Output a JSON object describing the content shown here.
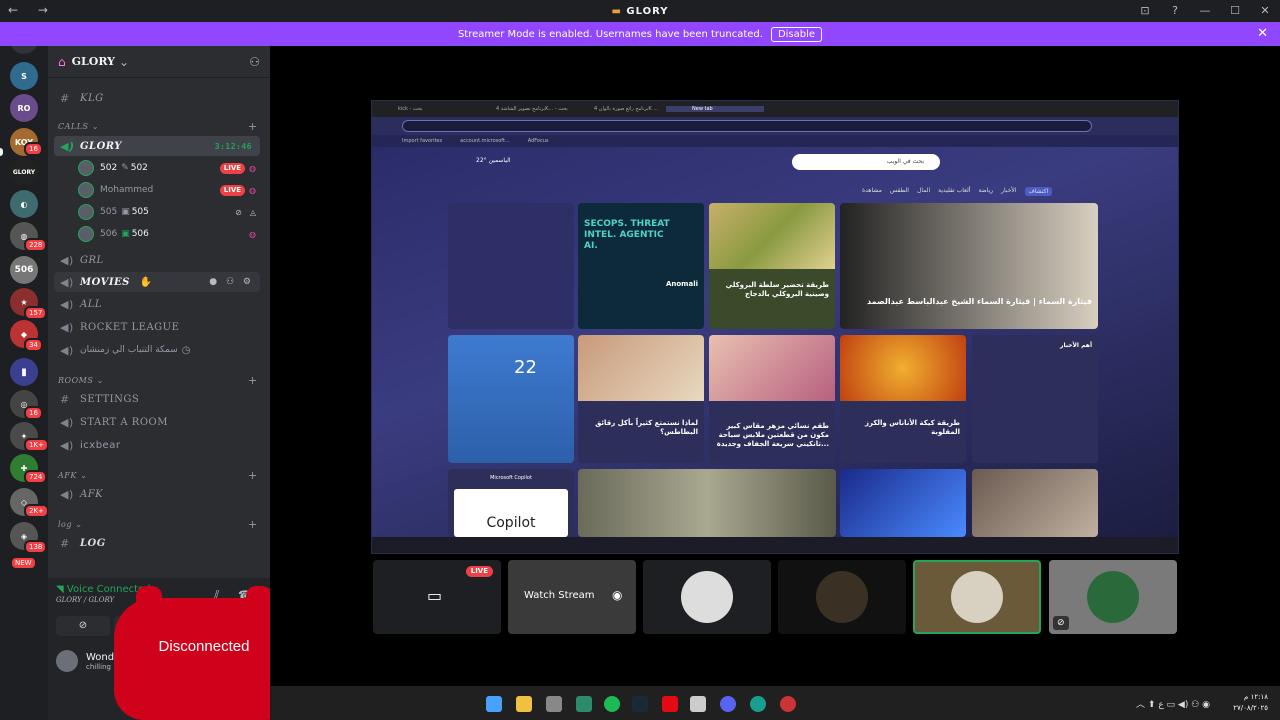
{
  "window": {
    "title": "GLORY",
    "nav_glyphs": "← →",
    "controls": [
      "⊡",
      "?",
      "—",
      "☐",
      "✕"
    ]
  },
  "banner": {
    "text": "Streamer Mode is enabled. Usernames have been truncated.",
    "disable_label": "Disable",
    "close": "✕"
  },
  "rail": {
    "badges": [
      "16",
      "228",
      "157",
      "34",
      "16",
      "1K+",
      "724",
      "2K+",
      "138",
      "NEW"
    ]
  },
  "server": {
    "name": "GLORY",
    "chevron": "⌄"
  },
  "channels": {
    "klg": "KLG",
    "calls_category": "CALLS",
    "glory": "GLORY",
    "glory_timer": "3:12:46",
    "voice_users": [
      {
        "name": "502",
        "tag": "502",
        "live": "LIVE"
      },
      {
        "name": "Mohammed",
        "tag": "",
        "live": "LIVE"
      },
      {
        "name": "505",
        "tag": "505",
        "live": ""
      },
      {
        "name": "506",
        "tag": "506",
        "live": ""
      }
    ],
    "grl": "GRL",
    "movies": "MOVIES",
    "all": "ALL",
    "rocket_league": "ROCKET LEAGUE",
    "arabic_channel": "سمكة التنباب الي زمنشان",
    "rooms_category": "ROOMS",
    "settings": "SETTINGS",
    "start_a_room": "START A ROOM",
    "icxbear": "icxbear",
    "afk_category": "AFK",
    "afk": "AFK",
    "log_category": "log",
    "log": "LOG"
  },
  "voice_panel": {
    "status": "Voice Connected",
    "location": "GLORY / GLORY",
    "user_name": "Wonder",
    "user_status": "chilling"
  },
  "overlay": {
    "disconnected": "Disconnected"
  },
  "stream": {
    "browser_tabs": [
      "kick - بحث",
      "برنامج تصوير الشاشة 4K... - بحث",
      "برنامج رائع صورة بألوان 4K ...",
      "New tab"
    ],
    "favorites": [
      "Import favorites",
      "account.microsoft...",
      "AdFocus"
    ],
    "msn_search_placeholder": "بحث في الويب",
    "weather_temp": "22°",
    "weather_city": "الياسمين",
    "msn_nav": [
      "اكتشاف",
      "الأخبار",
      "رياضة",
      "ألعاب تقليدية",
      "المال",
      "الطقس",
      "مشاهدة"
    ],
    "cards": [
      {
        "caption": "Anomali",
        "text": "SECOPS. THREAT INTEL. AGENTIC AI."
      },
      {
        "caption": "طريقة تحضير سلطة البروكلي وصينية البروكلي بالدجاج"
      },
      {
        "caption": "قيثارة السماء | قيثارة السماء الشيخ عبدالباسط عبدالصمد"
      },
      {
        "caption": "لماذا نستمتع كثيراً بأكل رقائق البطاطس؟"
      },
      {
        "caption": "طقم نسائي مزهر مقاس كبير مكون من قطعتين ملابس سباحة تانكيني سريعة الجفاف وجديدة..."
      },
      {
        "caption": "طريقة كيكة الأناناس والكرز المقلوبة"
      },
      {
        "caption": "أهم الأخبار"
      },
      {
        "caption": "Microsoft Copilot",
        "text": "Copilot"
      }
    ],
    "weather_widget_temp": "22"
  },
  "tiles": {
    "live": "LIVE",
    "watch": "Watch Stream"
  },
  "taskbar": {
    "clock_time": "١٢:١٨ م",
    "clock_date": "٢٧/٠٨/٢٠٢٥"
  },
  "colors": {
    "accent": "#9147ff",
    "voice_green": "#23a55a",
    "live_red": "#ed4245",
    "disconnected_red": "#d0021b"
  }
}
